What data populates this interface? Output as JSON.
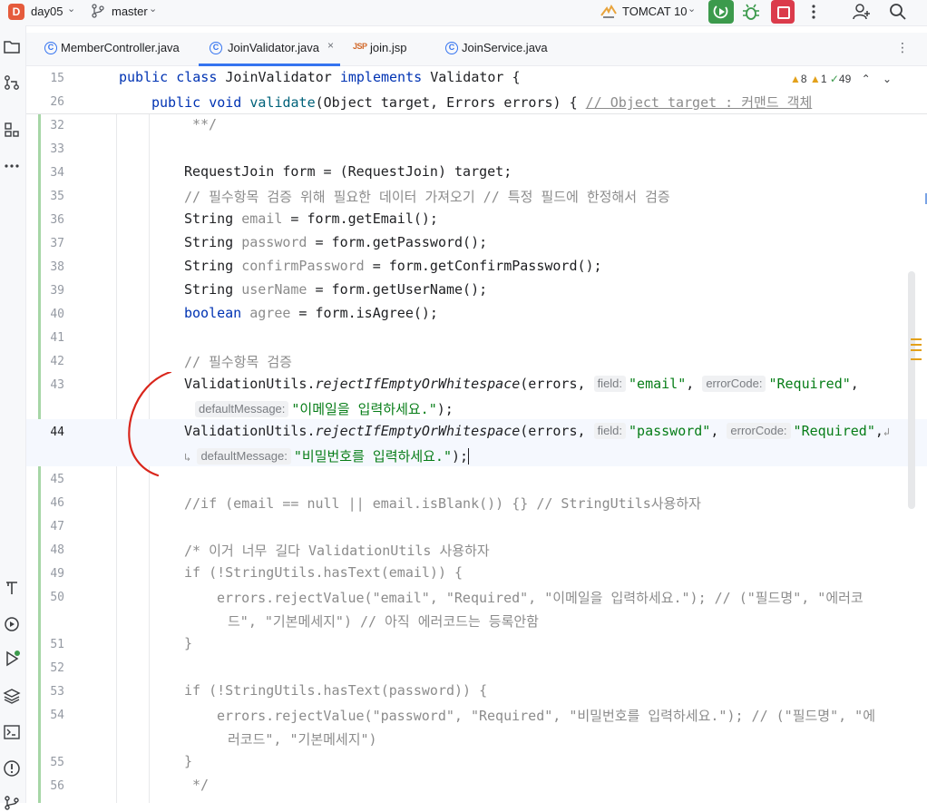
{
  "toolbar": {
    "project_badge": "D",
    "project_name": "day05",
    "branch": "master",
    "run_config": "TOMCAT 10"
  },
  "tabs": [
    {
      "label": "MemberController.java",
      "icon": "class-icon"
    },
    {
      "label": "JoinValidator.java",
      "icon": "class-icon",
      "active": true
    },
    {
      "label": "join.jsp",
      "icon": "jsp-icon"
    },
    {
      "label": "JoinService.java",
      "icon": "class-icon"
    }
  ],
  "tab_close": "×",
  "inspections": {
    "warnings": "8",
    "weak_warnings": "1",
    "ok": "49"
  },
  "sticky_lines": [
    {
      "num": "15",
      "text": "public class JoinValidator implements Validator {"
    },
    {
      "num": "26",
      "text": "public void validate(Object target, Errors errors) { // Object target : 커맨드 객체"
    }
  ],
  "lines": [
    {
      "num": "32",
      "text": "**/"
    },
    {
      "num": "33",
      "text": ""
    },
    {
      "num": "34",
      "text": "RequestJoin form = (RequestJoin) target;"
    },
    {
      "num": "35",
      "text": "// 필수항목 검증 위해 필요한 데이터 가져오기 // 특정 필드에 한정해서 검증"
    },
    {
      "num": "36",
      "text": "String email = form.getEmail();"
    },
    {
      "num": "37",
      "text": "String password = form.getPassword();"
    },
    {
      "num": "38",
      "text": "String confirmPassword = form.getConfirmPassword();"
    },
    {
      "num": "39",
      "text": "String userName = form.getUserName();"
    },
    {
      "num": "40",
      "text": "boolean agree = form.isAgree();"
    },
    {
      "num": "41",
      "text": ""
    },
    {
      "num": "42",
      "text": "// 필수항목 검증"
    },
    {
      "num": "43",
      "text": "ValidationUtils.rejectIfEmptyOrWhitespace(errors, field: \"email\", errorCode: \"Required\", defaultMessage: \"이메일을 입력하세요.\");"
    },
    {
      "num": "44",
      "text": "ValidationUtils.rejectIfEmptyOrWhitespace(errors, field: \"password\", errorCode: \"Required\", defaultMessage: \"비밀번호를 입력하세요.\");"
    },
    {
      "num": "45",
      "text": ""
    },
    {
      "num": "46",
      "text": "//if (email == null || email.isBlank()) {} // StringUtils사용하자"
    },
    {
      "num": "47",
      "text": ""
    },
    {
      "num": "48",
      "text": "/* 이거 너무 길다 ValidationUtils 사용하자"
    },
    {
      "num": "49",
      "text": "if (!StringUtils.hasText(email)) {"
    },
    {
      "num": "50",
      "text": "errors.rejectValue(\"email\", \"Required\", \"이메일을 입력하세요.\"); // (\"필드명\", \"에러코드\", \"기본메세지\") // 아직 에러코드는 등록안함"
    },
    {
      "num": "51",
      "text": "}"
    },
    {
      "num": "52",
      "text": ""
    },
    {
      "num": "53",
      "text": "if (!StringUtils.hasText(password)) {"
    },
    {
      "num": "54",
      "text": "errors.rejectValue(\"password\", \"Required\", \"비밀번호를 입력하세요.\"); // (\"필드명\", \"에러코드\", \"기본메세지\")"
    },
    {
      "num": "55",
      "text": "}"
    },
    {
      "num": "56",
      "text": "*/"
    }
  ],
  "hints": {
    "field": "field:",
    "errorCode": "errorCode:",
    "defaultMessage": "defaultMessage:"
  },
  "colors": {
    "keyword": "#0033b3",
    "string": "#067d17",
    "comment": "#8c8c8c",
    "accent": "#3574f0",
    "annotation_ink": "#d9261c"
  }
}
